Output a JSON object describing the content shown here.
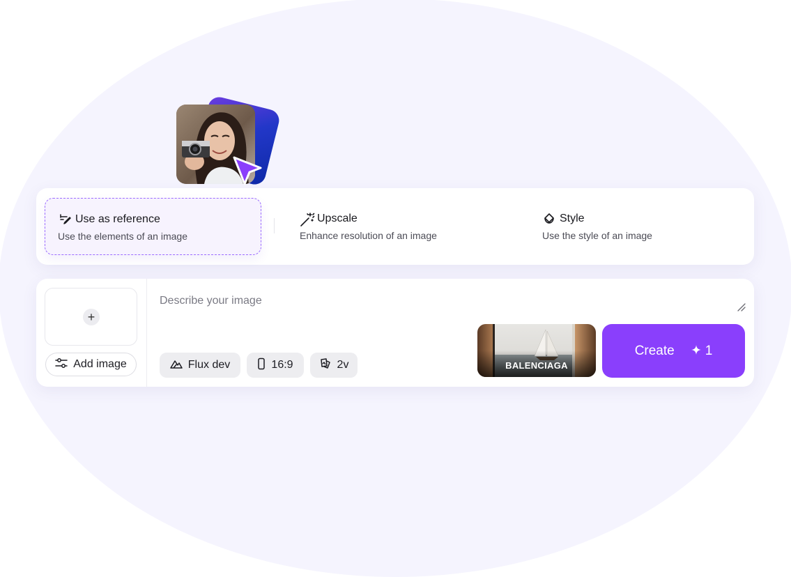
{
  "colors": {
    "accent": "#8a3ffc",
    "background_blob": "#f5f4fe",
    "selected_border": "#9b6bff"
  },
  "options": [
    {
      "title": "Use as reference",
      "description": "Use the elements of an image",
      "icon": "reference-icon",
      "selected": true
    },
    {
      "title": "Upscale",
      "description": "Enhance resolution of an image",
      "icon": "magic-wand-icon",
      "selected": false
    },
    {
      "title": "Style",
      "description": "Use the style of an image",
      "icon": "style-icon",
      "selected": false
    }
  ],
  "prompt": {
    "placeholder": "Describe your image",
    "value": ""
  },
  "add_image": {
    "label": "Add image",
    "icon": "sliders-icon"
  },
  "chips": {
    "model": "Flux dev",
    "aspect_ratio": "16:9",
    "variants": "2v"
  },
  "style_preset": {
    "label": "BALENCIAGA"
  },
  "create_button": {
    "label": "Create",
    "credits": "1"
  }
}
